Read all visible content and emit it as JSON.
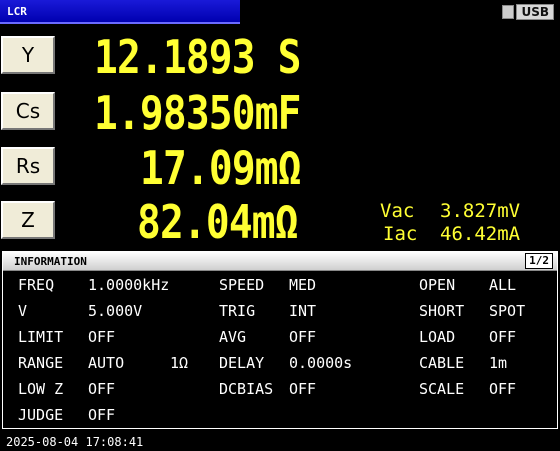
{
  "header": {
    "mode": "LCR",
    "usb": "USB"
  },
  "params": [
    {
      "key": "Y",
      "value": "12.1893 S"
    },
    {
      "key": "Cs",
      "value": "1.98350mF"
    },
    {
      "key": "Rs",
      "value": "17.09mΩ"
    },
    {
      "key": "Z",
      "value": "82.04mΩ"
    }
  ],
  "monitor": {
    "vac_label": "Vac",
    "vac_value": "3.827mV",
    "iac_label": "Iac",
    "iac_value": "46.42mA"
  },
  "info": {
    "title": "INFORMATION",
    "page": "1/2",
    "rows": [
      [
        "FREQ",
        "1.0000kHz",
        "",
        "SPEED",
        "MED",
        "OPEN",
        "ALL"
      ],
      [
        "V",
        "5.000V",
        "",
        "TRIG",
        "INT",
        "SHORT",
        "SPOT"
      ],
      [
        "LIMIT",
        "OFF",
        "",
        "AVG",
        "OFF",
        "LOAD",
        "OFF"
      ],
      [
        "RANGE",
        "AUTO",
        "1Ω",
        "DELAY",
        "0.0000s",
        "CABLE",
        "1m"
      ],
      [
        "LOW Z",
        "OFF",
        "",
        "DCBIAS",
        "OFF",
        "SCALE",
        "OFF"
      ],
      [
        "JUDGE",
        "OFF",
        "",
        "",
        "",
        "",
        ""
      ]
    ]
  },
  "timestamp": "2025-08-04 17:08:41"
}
